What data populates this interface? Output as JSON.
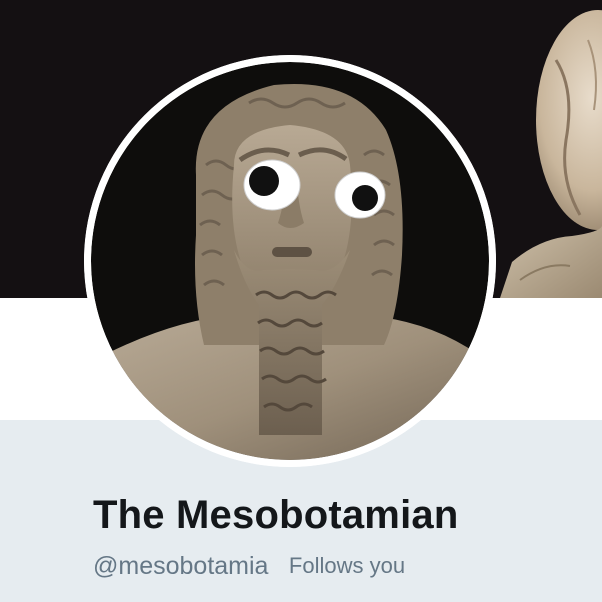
{
  "profile": {
    "display_name": "The Mesobotamian",
    "handle": "@mesobotamia",
    "follows_badge": "Follows you"
  },
  "colors": {
    "banner_background": "#141012",
    "page_background": "#e6ecf0",
    "name_text": "#14171a",
    "secondary_text": "#657786",
    "avatar_border": "#ffffff"
  },
  "icons": {
    "avatar": "sumerian-statue-with-googly-eyes"
  }
}
